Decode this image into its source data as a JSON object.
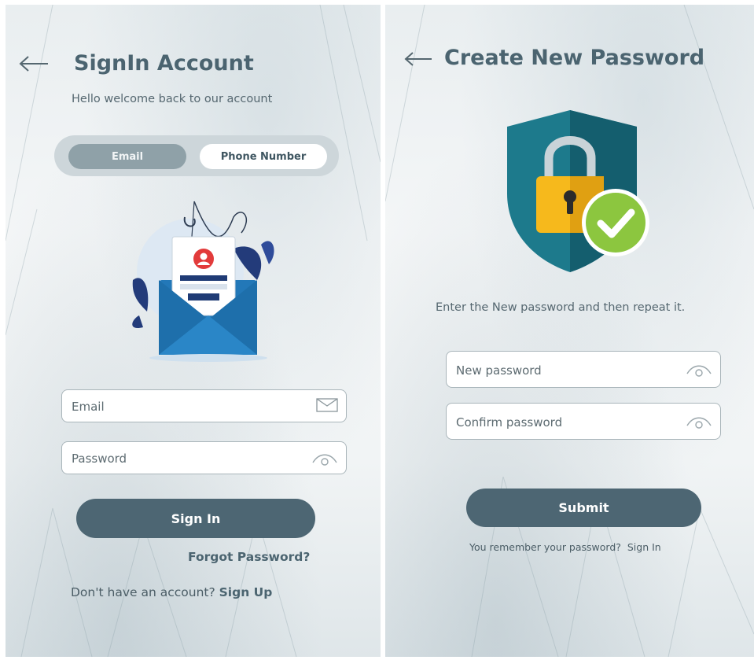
{
  "signin": {
    "title": "SignIn Account",
    "subtitle": "Hello welcome back to our account",
    "toggle": {
      "email_label": "Email",
      "phone_label": "Phone Number",
      "active": "Email"
    },
    "email_field": {
      "placeholder": "Email",
      "value": ""
    },
    "password_field": {
      "placeholder": "Password",
      "value": ""
    },
    "sign_in_button": "Sign In",
    "forgot_password_link": "Forgot Password?",
    "no_account_text": "Don't have an account?",
    "sign_up_link": "Sign Up",
    "icons": {
      "back": "arrow-left-icon",
      "email": "envelope-icon",
      "password": "eye-icon"
    }
  },
  "create_password": {
    "title": "Create New Password",
    "instruction": "Enter the New password and then repeat it.",
    "new_password_field": {
      "placeholder": "New password",
      "value": ""
    },
    "confirm_password_field": {
      "placeholder": "Confirm password",
      "value": ""
    },
    "submit_button": "Submit",
    "remember_text": "You remember your password?",
    "sign_in_link": "Sign In",
    "icons": {
      "back": "arrow-left-icon",
      "illustration": "shield-lock-check-icon",
      "password": "eye-icon"
    }
  },
  "colors": {
    "primary": "#4d6673",
    "title": "#4b6470",
    "toggle_track": "#cdd6da",
    "toggle_active": "#8fa1a8",
    "shield": "#1d7a8c",
    "lock": "#f6b91c",
    "check": "#8cc63f"
  }
}
